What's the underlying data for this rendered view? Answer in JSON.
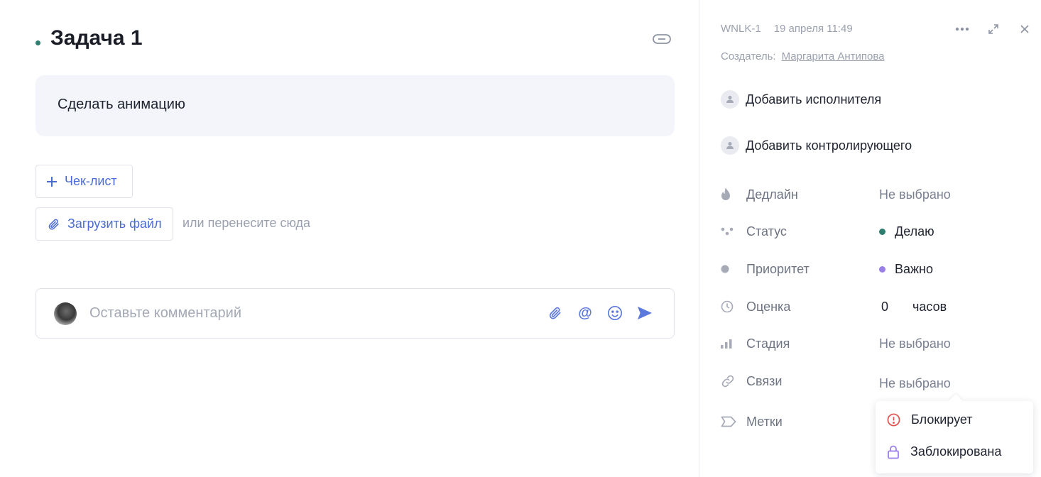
{
  "task": {
    "title": "Задача 1",
    "status_color": "#2e7d6f",
    "description": "Сделать анимацию"
  },
  "actions": {
    "checklist_label": "Чек-лист",
    "upload_label": "Загрузить файл",
    "drop_hint": "или перенесите сюда"
  },
  "comment": {
    "placeholder": "Оставьте комментарий"
  },
  "side": {
    "task_key": "WNLK-1",
    "created_at": "19 апреля 11:49",
    "creator_label": "Создатель:",
    "creator_name": "Маргарита Антипова",
    "add_assignee": "Добавить исполнителя",
    "add_controller": "Добавить контролирующего",
    "props": {
      "deadline": {
        "label": "Дедлайн",
        "value": "Не выбрано"
      },
      "status": {
        "label": "Статус",
        "value": "Делаю",
        "color": "#2e7d6f"
      },
      "priority": {
        "label": "Приоритет",
        "value": "Важно",
        "color": "#9b7fe8"
      },
      "estimate": {
        "label": "Оценка",
        "value": "0",
        "unit": "часов"
      },
      "stage": {
        "label": "Стадия",
        "value": "Не выбрано"
      },
      "links": {
        "label": "Связи",
        "value": "Не выбрано"
      },
      "tags": {
        "label": "Метки"
      }
    }
  },
  "dropdown": {
    "items": [
      {
        "label": "Блокирует",
        "icon": "alert-circle-icon",
        "color": "#e0524f"
      },
      {
        "label": "Заблокирована",
        "icon": "lock-icon",
        "color": "#9b7fe8"
      }
    ]
  },
  "colors": {
    "accent": "#4a6bd6",
    "muted": "#9aa0ad"
  }
}
